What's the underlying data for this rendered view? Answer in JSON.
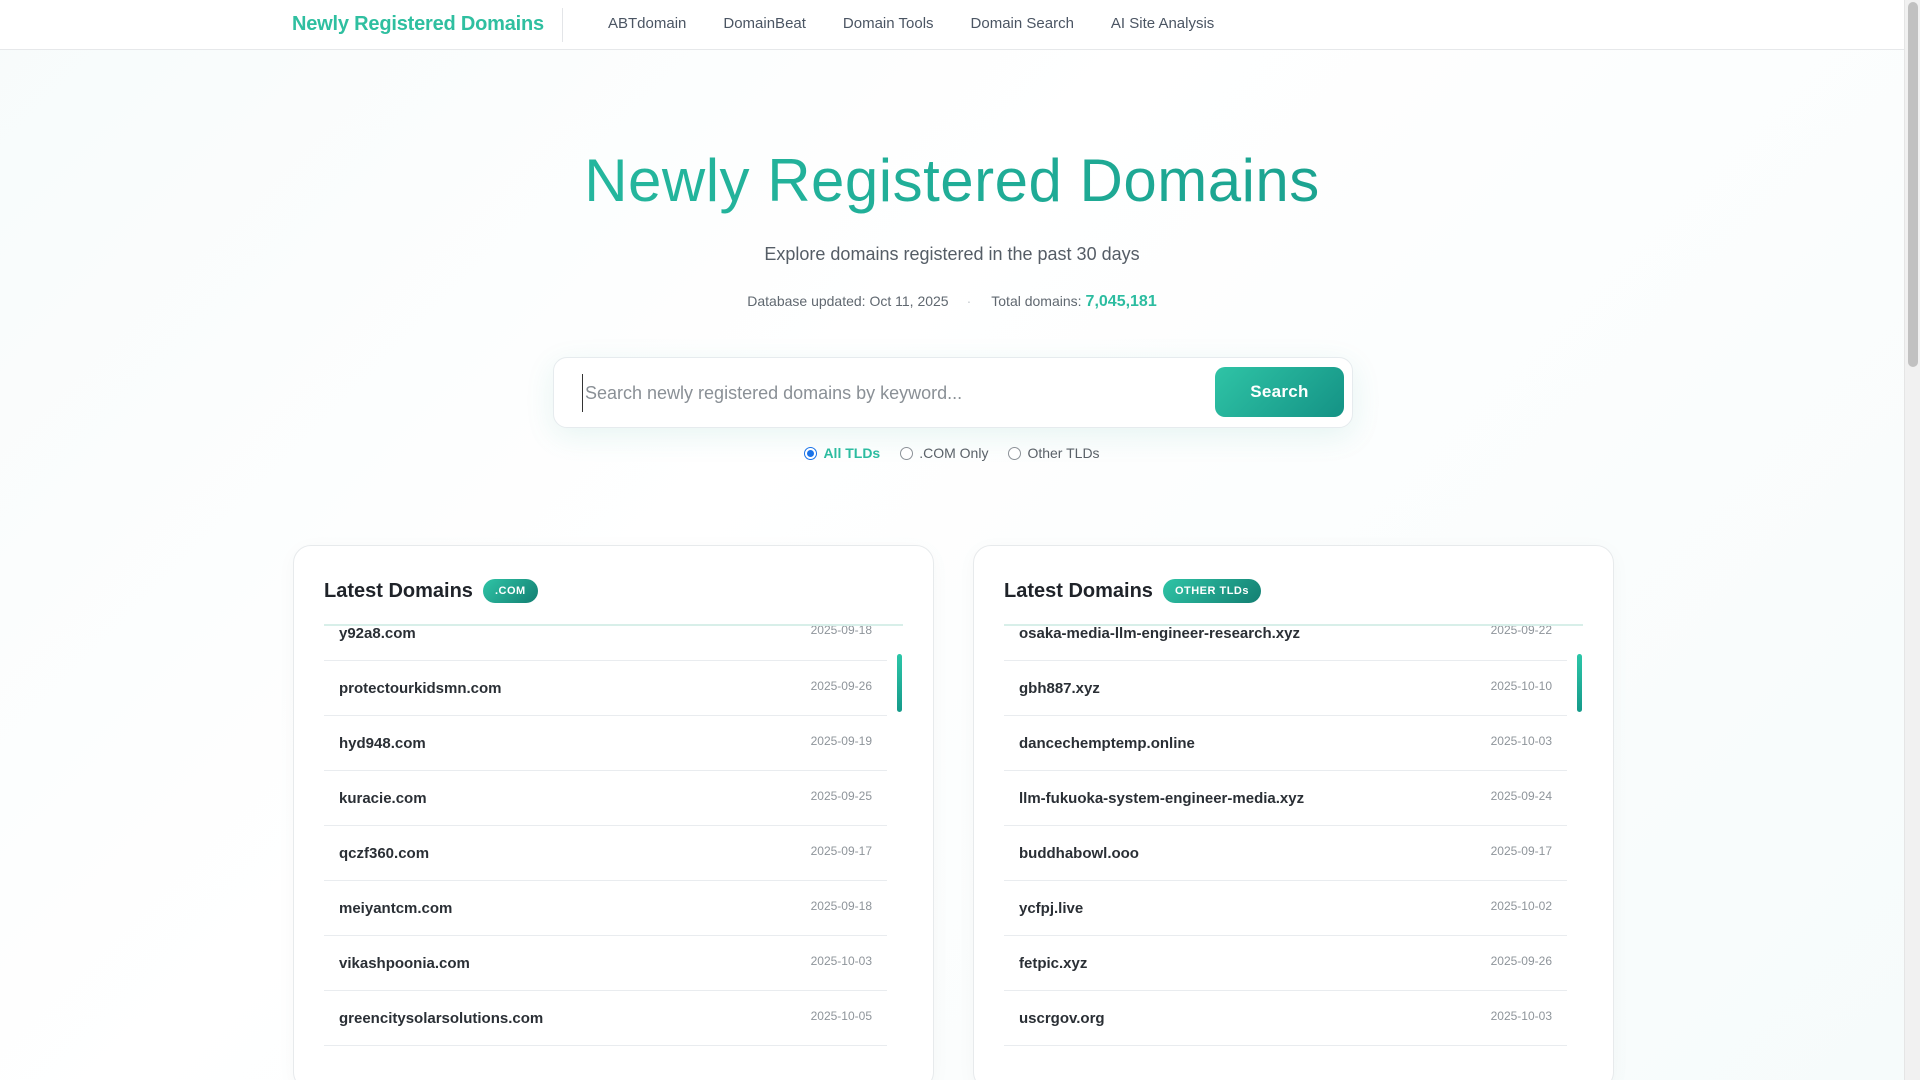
{
  "nav": {
    "brand": "Newly Registered Domains",
    "links": [
      "ABTdomain",
      "DomainBeat",
      "Domain Tools",
      "Domain Search",
      "AI Site Analysis"
    ]
  },
  "hero": {
    "title": "Newly Registered Domains",
    "subtitle": "Explore domains registered in the past 30 days",
    "updated_label": "Database updated: Oct 11, 2025",
    "total_label": "Total domains:",
    "total_value": "7,045,181"
  },
  "search": {
    "placeholder": "Search newly registered domains by keyword...",
    "button_label": "Search"
  },
  "filters": [
    {
      "label": "All TLDs",
      "checked": true
    },
    {
      "label": ".COM Only",
      "checked": false
    },
    {
      "label": "Other TLDs",
      "checked": false
    }
  ],
  "cards": [
    {
      "title": "Latest Domains",
      "badge": ".COM",
      "rows": [
        {
          "domain": "y92a8.com",
          "date": "2025-09-18"
        },
        {
          "domain": "protectourkidsmn.com",
          "date": "2025-09-26"
        },
        {
          "domain": "hyd948.com",
          "date": "2025-09-19"
        },
        {
          "domain": "kuracie.com",
          "date": "2025-09-25"
        },
        {
          "domain": "qczf360.com",
          "date": "2025-09-17"
        },
        {
          "domain": "meiyantcm.com",
          "date": "2025-09-18"
        },
        {
          "domain": "vikashpoonia.com",
          "date": "2025-10-03"
        },
        {
          "domain": "greencitysolarsolutions.com",
          "date": "2025-10-05"
        }
      ]
    },
    {
      "title": "Latest Domains",
      "badge": "OTHER TLDs",
      "rows": [
        {
          "domain": "osaka-media-llm-engineer-research.xyz",
          "date": "2025-09-22"
        },
        {
          "domain": "gbh887.xyz",
          "date": "2025-10-10"
        },
        {
          "domain": "dancechemptemp.online",
          "date": "2025-10-03"
        },
        {
          "domain": "llm-fukuoka-system-engineer-media.xyz",
          "date": "2025-09-24"
        },
        {
          "domain": "buddhabowl.ooo",
          "date": "2025-09-17"
        },
        {
          "domain": "ycfpj.live",
          "date": "2025-10-02"
        },
        {
          "domain": "fetpic.xyz",
          "date": "2025-09-26"
        },
        {
          "domain": "uscrgov.org",
          "date": "2025-10-03"
        }
      ]
    }
  ]
}
